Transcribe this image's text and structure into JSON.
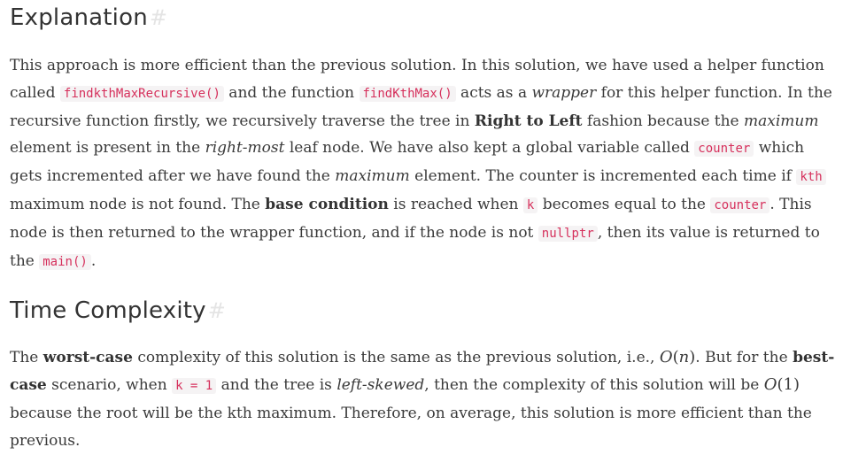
{
  "explanation": {
    "heading": "Explanation",
    "anchor": "#",
    "p": [
      "This approach is more efficient than the previous solution. In this solution, we have used a helper function called ",
      "findkthMaxRecursive()",
      " and the function ",
      "findKthMax()",
      " acts as a ",
      "wrapper",
      " for this helper function. In the recursive function firstly, we recursively traverse the tree in ",
      "Right to Left",
      " fashion because the ",
      "maximum",
      " element is present in the ",
      "right-most",
      " leaf node. We have also kept a global variable called ",
      "counter",
      " which gets incremented after we have found the ",
      "maximum",
      " element. The counter is incremented each time if ",
      "kth",
      " maximum node is not found. The ",
      "base condition",
      " is reached when ",
      "k",
      " becomes equal to the ",
      "counter",
      ". This node is then returned to the wrapper function, and if the node is not ",
      "nullptr",
      ", then its value is returned to the ",
      "main()",
      "."
    ]
  },
  "time": {
    "heading": "Time Complexity",
    "anchor": "#",
    "p": [
      "The ",
      "worst-case",
      " complexity of this solution is the same as the previous solution, i.e., ",
      "O",
      "(",
      "n",
      ")",
      ". But for the ",
      "best-case",
      " scenario, when ",
      "k = 1",
      " and the tree is ",
      "left-skewed",
      ", then the complexity of this solution will be ",
      "O",
      "(1)",
      " because the root will be the kth maximum. Therefore, on average, this solution is more efficient than the previous."
    ]
  },
  "colors": {
    "code_text": "#d6305c",
    "code_bg": "#f5f3f4",
    "body_text": "#3a3a3a",
    "anchor": "#e4e4e4"
  }
}
